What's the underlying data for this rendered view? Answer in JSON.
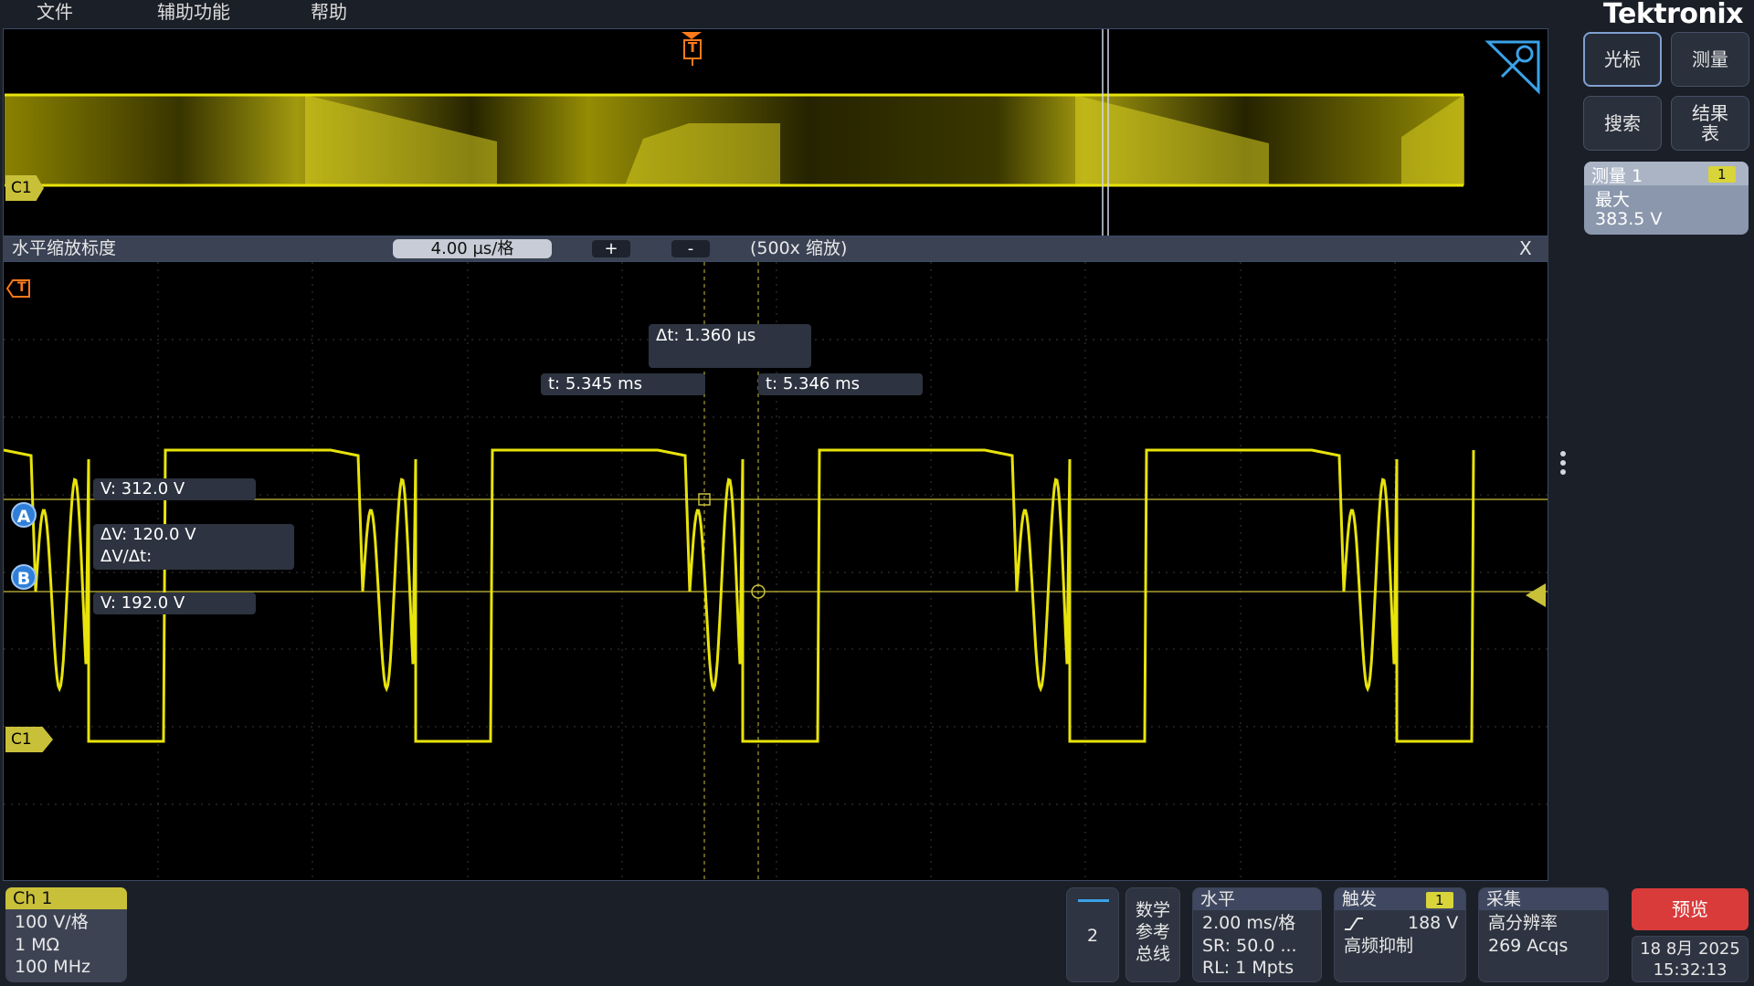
{
  "menu": [
    "文件",
    "辅助功能",
    "帮助"
  ],
  "brand": "Tektronix",
  "zoom_bar": {
    "title": "水平缩放标度",
    "scale": "4.00 µs/格",
    "plus": "+",
    "minus": "-",
    "factor": "(500x 缩放)",
    "close": "X"
  },
  "trigger_marker": "T",
  "channel_tag": "C1",
  "cursors": {
    "delta_t": "Δt:  1.360 µs",
    "t1": "t:     5.345 ms",
    "t2": "t:     5.346 ms",
    "va": "V:    312.0 V",
    "dv": "ΔV:       120.0 V",
    "dvdt": "ΔV/Δt:",
    "vb": "V:    192.0 V",
    "a_label": "A",
    "b_label": "B"
  },
  "right_panel": {
    "buttons": [
      "光标",
      "测量",
      "搜索",
      "结果\n表"
    ],
    "measurement": {
      "title": "测量 1",
      "badge": "1",
      "type": "最大",
      "value": "383.5 V"
    }
  },
  "bottom": {
    "channel": {
      "name": "Ch 1",
      "vdiv": "100 V/格",
      "impedance": "1 MΩ",
      "bandwidth": "100 MHz"
    },
    "add_channel": "2",
    "math": [
      "数学",
      "参考",
      "总线"
    ],
    "horizontal": {
      "title": "水平",
      "scale": "2.00 ms/格",
      "sr": "SR: 50.0 ...",
      "rl": "RL: 1 Mpts"
    },
    "trigger": {
      "title": "触发",
      "badge": "1",
      "level": "188 V",
      "mode": "高频抑制"
    },
    "acquire": {
      "title": "采集",
      "mode": "高分辨率",
      "count": "269 Acqs"
    },
    "preview": "预览",
    "date": "18 8月 2025",
    "time": "15:32:13"
  },
  "colors": {
    "trace": "#e8e30a",
    "accent_blue": "#2f7fd9",
    "preview_red": "#d93b3b"
  }
}
